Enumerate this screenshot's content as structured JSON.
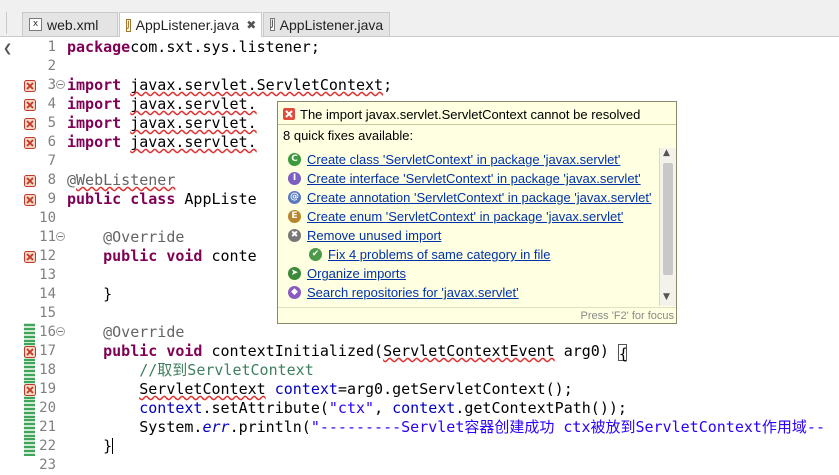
{
  "tabs": [
    {
      "label": "web.xml",
      "icon": "xml-file-icon"
    },
    {
      "label": "AppListener.java",
      "icon": "java-error-file-icon",
      "active": true
    },
    {
      "label": "AppListener.java",
      "icon": "java-file-icon"
    }
  ],
  "close_glyph": "✖",
  "lines": [
    {
      "n": "1",
      "parts": [
        [
          "kw",
          "package"
        ],
        [
          "",
          "com.sxt.sys.listener;"
        ]
      ]
    },
    {
      "n": "2",
      "parts": []
    },
    {
      "n": "3",
      "parts": [
        [
          "kw",
          "import"
        ],
        [
          "",
          " "
        ],
        [
          "sq",
          "javax.servlet.ServletContext"
        ],
        [
          "",
          ";"
        ]
      ],
      "fold": true,
      "error": true
    },
    {
      "n": "4",
      "parts": [
        [
          "kw",
          "import"
        ],
        [
          "",
          " "
        ],
        [
          "sq",
          "javax.servlet."
        ]
      ],
      "error": true
    },
    {
      "n": "5",
      "parts": [
        [
          "kw",
          "import"
        ],
        [
          "",
          " "
        ],
        [
          "sq",
          "javax.servlet."
        ]
      ],
      "error": true
    },
    {
      "n": "6",
      "parts": [
        [
          "kw",
          "import"
        ],
        [
          "",
          " "
        ],
        [
          "sq",
          "javax.servlet."
        ]
      ],
      "error": true
    },
    {
      "n": "7",
      "parts": []
    },
    {
      "n": "8",
      "parts": [
        [
          "an",
          "@"
        ],
        [
          "sq an",
          "WebListener"
        ]
      ],
      "error": true
    },
    {
      "n": "9",
      "parts": [
        [
          "kw",
          "public"
        ],
        [
          "",
          " "
        ],
        [
          "kw",
          "class"
        ],
        [
          "",
          " AppListe"
        ]
      ],
      "error": true
    },
    {
      "n": "10",
      "parts": []
    },
    {
      "n": "11",
      "parts": [
        [
          "",
          "    "
        ],
        [
          "an",
          "@Override"
        ]
      ],
      "fold": true
    },
    {
      "n": "12",
      "parts": [
        [
          "",
          "    "
        ],
        [
          "kw",
          "public"
        ],
        [
          "",
          " "
        ],
        [
          "kw",
          "void"
        ],
        [
          "",
          " conte"
        ]
      ],
      "error": true
    },
    {
      "n": "13",
      "parts": []
    },
    {
      "n": "14",
      "parts": [
        [
          "",
          "    }"
        ]
      ]
    },
    {
      "n": "15",
      "parts": []
    },
    {
      "n": "16",
      "parts": [
        [
          "",
          "    "
        ],
        [
          "an",
          "@Override"
        ]
      ],
      "fold": true,
      "green": true
    },
    {
      "n": "17",
      "parts": [
        [
          "",
          "    "
        ],
        [
          "kw",
          "public"
        ],
        [
          "",
          " "
        ],
        [
          "kw",
          "void"
        ],
        [
          "",
          " contextInitialized("
        ],
        [
          "sq",
          "ServletContextEvent"
        ],
        [
          "",
          " arg0) "
        ],
        [
          "box",
          "{"
        ]
      ],
      "error": true,
      "green": true
    },
    {
      "n": "18",
      "parts": [
        [
          "",
          "        "
        ],
        [
          "cm",
          "//取到ServletContext"
        ]
      ],
      "green": true
    },
    {
      "n": "19",
      "parts": [
        [
          "",
          "        "
        ],
        [
          "sq",
          "ServletContext"
        ],
        [
          "",
          " "
        ],
        [
          "fld",
          "context"
        ],
        [
          "",
          "=arg0.getServletContext();"
        ]
      ],
      "error": true,
      "green": true
    },
    {
      "n": "20",
      "parts": [
        [
          "",
          "        "
        ],
        [
          "fld",
          "context"
        ],
        [
          "",
          ".setAttribute("
        ],
        [
          "st",
          "\"ctx\""
        ],
        [
          "",
          ", "
        ],
        [
          "fld",
          "context"
        ],
        [
          "",
          ".getContextPath());"
        ]
      ],
      "green": true
    },
    {
      "n": "21",
      "parts": [
        [
          "",
          "        System."
        ],
        [
          "fld it",
          "err"
        ],
        [
          "",
          ".println("
        ],
        [
          "st",
          "\"---------Servlet容器创建成功 ctx被放到ServletContext作用域--"
        ]
      ],
      "green": true
    },
    {
      "n": "22",
      "parts": [
        [
          "",
          "    }"
        ]
      ],
      "current": true,
      "green": true
    },
    {
      "n": "23",
      "parts": []
    }
  ],
  "quickfix": {
    "title": "The import javax.servlet.ServletContext cannot be resolved",
    "count_text": "8 quick fixes available:",
    "items": [
      {
        "label": "Create class 'ServletContext' in package 'javax.servlet'",
        "icon": "class-icon",
        "glyph": "C",
        "color": "#3b9a3b"
      },
      {
        "label": "Create interface 'ServletContext' in package 'javax.servlet'",
        "icon": "interface-icon",
        "glyph": "I",
        "color": "#7b5fc2"
      },
      {
        "label": "Create annotation 'ServletContext' in package 'javax.servlet'",
        "icon": "annotation-icon",
        "glyph": "@",
        "color": "#5a7ac0"
      },
      {
        "label": "Create enum 'ServletContext' in package 'javax.servlet'",
        "icon": "enum-icon",
        "glyph": "E",
        "color": "#b8862b"
      },
      {
        "label": "Remove unused import",
        "icon": "remove-import-icon",
        "glyph": "✖",
        "color": "#777777"
      },
      {
        "label": "Fix 4 problems of same category in file",
        "icon": "fix-problems-icon",
        "glyph": "✔",
        "color": "#4a9a4a"
      },
      {
        "label": "Organize imports",
        "icon": "organize-imports-icon",
        "glyph": "➤",
        "color": "#3a8a3a"
      },
      {
        "label": "Search repositories for 'javax.servlet'",
        "icon": "search-repositories-icon",
        "glyph": "◆",
        "color": "#8a5cc2"
      }
    ],
    "footer": "Press 'F2' for focus"
  }
}
